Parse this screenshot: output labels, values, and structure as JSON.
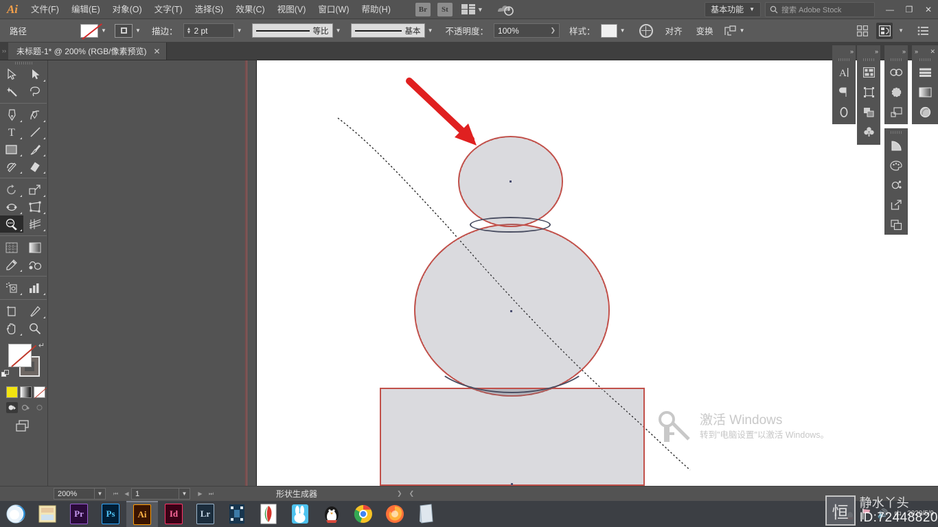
{
  "app": {
    "name": "Ai",
    "title": "Adobe Illustrator"
  },
  "menubar": {
    "items": [
      {
        "label": "文件(F)",
        "name": "menu-file"
      },
      {
        "label": "编辑(E)",
        "name": "menu-edit"
      },
      {
        "label": "对象(O)",
        "name": "menu-object"
      },
      {
        "label": "文字(T)",
        "name": "menu-type"
      },
      {
        "label": "选择(S)",
        "name": "menu-select"
      },
      {
        "label": "效果(C)",
        "name": "menu-effect"
      },
      {
        "label": "视图(V)",
        "name": "menu-view"
      },
      {
        "label": "窗口(W)",
        "name": "menu-window"
      },
      {
        "label": "帮助(H)",
        "name": "menu-help"
      }
    ],
    "bridge_label": "Br",
    "stock_label": "St",
    "workspace": "基本功能",
    "search_placeholder": "搜索 Adobe Stock",
    "minimize": "—",
    "restore": "❐",
    "close": "✕"
  },
  "controlbar": {
    "selection_label": "路径",
    "fill_swatch": "none",
    "stroke_swatch": "stroke-box",
    "stroke_label": "描边：",
    "stroke_weight": "2 pt",
    "profile_label": "等比",
    "brush_label": "基本",
    "opacity_label": "不透明度：",
    "opacity_value": "100%",
    "style_label": "样式：",
    "align_label": "对齐",
    "transform_label": "变换",
    "accent_color": "#c1504a"
  },
  "tabs": [
    {
      "title": "未标题-1* @ 200% (RGB/像素预览)",
      "close": "✕",
      "active": true
    }
  ],
  "toolbar": {
    "tools": [
      {
        "name": "selection-tool",
        "label": "选择工具"
      },
      {
        "name": "direct-selection-tool",
        "label": "直接选择工具"
      },
      {
        "name": "magic-wand-tool",
        "label": "魔棒工具"
      },
      {
        "name": "lasso-tool",
        "label": "套索工具"
      },
      {
        "name": "pen-tool",
        "label": "钢笔工具"
      },
      {
        "name": "curvature-tool",
        "label": "曲率工具"
      },
      {
        "name": "type-tool",
        "label": "文字工具"
      },
      {
        "name": "line-segment-tool",
        "label": "直线段工具"
      },
      {
        "name": "rectangle-tool",
        "label": "矩形工具"
      },
      {
        "name": "paintbrush-tool",
        "label": "画笔工具"
      },
      {
        "name": "shaper-tool",
        "label": "Shaper 工具"
      },
      {
        "name": "eraser-tool",
        "label": "橡皮擦工具"
      },
      {
        "name": "rotate-tool",
        "label": "旋转工具"
      },
      {
        "name": "scale-tool",
        "label": "比例缩放工具"
      },
      {
        "name": "width-tool",
        "label": "宽度工具"
      },
      {
        "name": "free-transform-tool",
        "label": "自由变换工具"
      },
      {
        "name": "shape-builder-tool",
        "label": "形状生成器工具",
        "selected": true
      },
      {
        "name": "perspective-grid-tool",
        "label": "透视网格工具"
      },
      {
        "name": "mesh-tool",
        "label": "网格工具"
      },
      {
        "name": "gradient-tool",
        "label": "渐变工具"
      },
      {
        "name": "eyedropper-tool",
        "label": "吸管工具"
      },
      {
        "name": "blend-tool",
        "label": "混合工具"
      },
      {
        "name": "symbol-sprayer-tool",
        "label": "符号喷枪工具"
      },
      {
        "name": "column-graph-tool",
        "label": "柱形图工具"
      },
      {
        "name": "artboard-tool",
        "label": "画板工具"
      },
      {
        "name": "slice-tool",
        "label": "切片工具"
      },
      {
        "name": "hand-tool",
        "label": "抓手工具"
      },
      {
        "name": "zoom-tool",
        "label": "缩放工具"
      }
    ],
    "fill_state": "无",
    "stroke_state": "描边",
    "color_modes": [
      "颜色",
      "渐变",
      "无"
    ],
    "draw_modes": [
      "正常绘图",
      "背面绘图",
      "内部绘图"
    ],
    "screen_mode": "更改屏幕模式"
  },
  "canvas": {
    "zoom": "200%",
    "shapes": [
      {
        "name": "circle-head",
        "type": "ellipse",
        "stroke": "#c1504a",
        "highlight": true
      },
      {
        "name": "circle-body",
        "type": "ellipse",
        "stroke": "#c1504a",
        "highlight": true
      },
      {
        "name": "rectangle-base",
        "type": "rect",
        "stroke": "#c1504a",
        "highlight": true
      },
      {
        "name": "ellipse-overlap",
        "type": "ellipse",
        "stroke": "#4a4e62",
        "highlight": false
      },
      {
        "name": "arc-overlap",
        "type": "arc",
        "stroke": "#4a4e62",
        "highlight": false
      }
    ],
    "annotation_arrow": {
      "name": "red-arrow-annotation",
      "color": "#e02020"
    },
    "shape_builder_path": {
      "name": "shape-builder-drag-path",
      "style": "dashed"
    }
  },
  "panels": {
    "group1": [
      "character-panel",
      "paragraph-panel",
      "opentype-panel"
    ],
    "group2": [
      "artboards-panel",
      "transform-panel",
      "pathfinder-panel",
      "symbols-panel"
    ],
    "group3": [
      "libraries-panel",
      "brushes-panel",
      "layers-thumb-panel"
    ],
    "group4": [
      "properties-panel",
      "gradient-panel",
      "appearance-panel"
    ],
    "group5": [
      "color-guide-panel",
      "swatches-panel",
      "graphic-styles-panel",
      "links-panel",
      "artboard-stack-panel"
    ],
    "collapse": "»",
    "close": "✕"
  },
  "statusbar": {
    "zoom_value": "200%",
    "page_value": "1",
    "tool_name": "形状生成器",
    "next_arrow": "❯",
    "prev_arrow": "❮"
  },
  "taskbar": {
    "apps": [
      {
        "name": "taskbar-browser-360",
        "label": ""
      },
      {
        "name": "taskbar-file-explorer",
        "label": ""
      },
      {
        "name": "taskbar-premiere",
        "label": "Pr",
        "color": "#2a0a3a",
        "border": "#9a5bd4"
      },
      {
        "name": "taskbar-photoshop",
        "label": "Ps",
        "color": "#001e36",
        "border": "#31a8ff"
      },
      {
        "name": "taskbar-illustrator",
        "label": "Ai",
        "color": "#330000",
        "border": "#ff9a00",
        "active": true
      },
      {
        "name": "taskbar-indesign",
        "label": "Id",
        "color": "#3b0016",
        "border": "#ff3366"
      },
      {
        "name": "taskbar-lightroom",
        "label": "Lr",
        "color": "#001e36",
        "border": "#9bb5cc"
      },
      {
        "name": "taskbar-video-editor",
        "label": ""
      },
      {
        "name": "taskbar-wps",
        "label": ""
      },
      {
        "name": "taskbar-rabbit-app",
        "label": ""
      },
      {
        "name": "taskbar-qq",
        "label": ""
      },
      {
        "name": "taskbar-chrome",
        "label": ""
      },
      {
        "name": "taskbar-firefox",
        "label": ""
      },
      {
        "name": "taskbar-notes",
        "label": ""
      }
    ],
    "tray": {
      "expand": "▲",
      "date": "2020/5/9",
      "icons": [
        "qq-tray-icon",
        "flag-tray-icon",
        "volume-tray-icon",
        "ime-tray-icon"
      ]
    }
  },
  "windows_activation": {
    "title": "激活 Windows",
    "subtitle": "转到\"电脑设置\"以激活 Windows。",
    "icon": "key-icon"
  },
  "watermark": {
    "logo_char": "恒",
    "nickname": "静水丫头",
    "id": "ID:72448820",
    "date": "2020/5/9"
  }
}
